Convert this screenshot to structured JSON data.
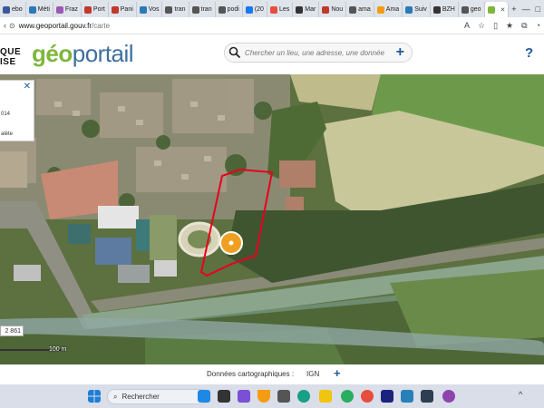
{
  "browser": {
    "tabs": [
      {
        "label": "ebo",
        "color": "#3b5998"
      },
      {
        "label": "Méti",
        "color": "#2a7ab8"
      },
      {
        "label": "Fraz",
        "color": "#9b59b6"
      },
      {
        "label": "Port",
        "color": "#c0392b"
      },
      {
        "label": "Pani",
        "color": "#c0392b"
      },
      {
        "label": "Vos",
        "color": "#2a7ab8"
      },
      {
        "label": "tran",
        "color": "#555"
      },
      {
        "label": "tran",
        "color": "#555"
      },
      {
        "label": "podi",
        "color": "#555"
      },
      {
        "label": "(20",
        "color": "#1877f2"
      },
      {
        "label": "Les",
        "color": "#e74c3c"
      },
      {
        "label": "Mar",
        "color": "#333"
      },
      {
        "label": "Nou",
        "color": "#c0392b"
      },
      {
        "label": "ama",
        "color": "#555"
      },
      {
        "label": "Ama",
        "color": "#f39c12"
      },
      {
        "label": "Suiv",
        "color": "#2a7ab8"
      },
      {
        "label": "BZH",
        "color": "#333"
      },
      {
        "label": "geo",
        "color": "#555"
      },
      {
        "label": "",
        "color": "#7fb63d",
        "active": true
      }
    ],
    "url_host": "www.geoportail.gouv.fr",
    "url_path": "/carte"
  },
  "header": {
    "rf_line1": "QUE",
    "rf_line2": "ISE",
    "logo_geo": "géo",
    "logo_portail": "portail",
    "search_placeholder": "Chercher un lieu, une adresse, une donnée",
    "help": "?"
  },
  "info_panel": {
    "close": "✕",
    "line1": "014",
    "line2": "alète"
  },
  "scale": {
    "value": "2 861",
    "bar_label": "100 m"
  },
  "footer": {
    "label": "Données cartographiques :",
    "source": "IGN",
    "plus": "+"
  },
  "taskbar": {
    "search_label": "Rechercher"
  },
  "colors": {
    "accent": "#1c5a9a",
    "logo_green": "#7fb63d",
    "logo_blue": "#3e6f9e",
    "parcel_outline": "#e8001c",
    "marker": "#f0a020"
  }
}
